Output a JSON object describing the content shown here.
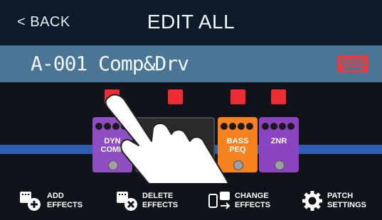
{
  "header": {
    "back_label": "< BACK",
    "title": "EDIT ALL"
  },
  "patch": {
    "name": "A-001 Comp&Drv"
  },
  "effects": [
    {
      "name": "DYN COMP",
      "color": "#8f4fc2"
    },
    {
      "name": "",
      "color": "#2a2a2a"
    },
    {
      "name": "BASS PEQ",
      "color": "#f5821f"
    },
    {
      "name": "ZNR",
      "color": "#8a44c0"
    }
  ],
  "toolbar": {
    "add_label": "ADD EFFECTS",
    "delete_label": "DELETE EFFECTS",
    "change_label": "CHANGE EFFECTS",
    "settings_label": "PATCH SETTINGS"
  },
  "colors": {
    "header_bg": "#0c1a2a",
    "patch_bar": "#4a7595",
    "signal_line": "#2f5db6",
    "select_marker": "#ee2c35",
    "keyboard_icon": "#e23d43"
  }
}
